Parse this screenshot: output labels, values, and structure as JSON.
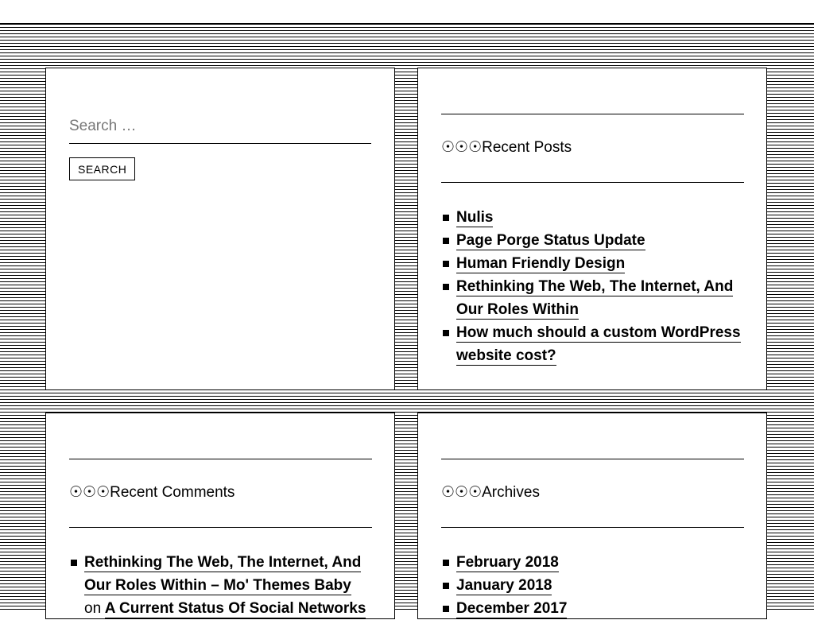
{
  "search": {
    "placeholder": "Search …",
    "button_label": "SEARCH"
  },
  "recent_posts": {
    "title": "☉☉☉Recent Posts",
    "items": [
      {
        "label": "Nulis"
      },
      {
        "label": "Page Porge Status Update"
      },
      {
        "label": "Human Friendly Design"
      },
      {
        "label": "Rethinking The Web, The Internet, And Our Roles Within"
      },
      {
        "label": "How much should a custom WordPress website cost?"
      }
    ]
  },
  "recent_comments": {
    "title": "☉☉☉Recent Comments",
    "items": [
      {
        "author": "Rethinking The Web, The Internet, And Our Roles Within – Mo' Themes Baby",
        "on": "on",
        "post": "A Current Status Of Social Networks"
      }
    ]
  },
  "archives": {
    "title": "☉☉☉Archives",
    "items": [
      {
        "label": "February 2018"
      },
      {
        "label": "January 2018"
      },
      {
        "label": "December 2017"
      }
    ]
  },
  "colors": {
    "background": "#ffffff",
    "stripe": "#000000",
    "text": "#000000",
    "placeholder": "#777777"
  }
}
